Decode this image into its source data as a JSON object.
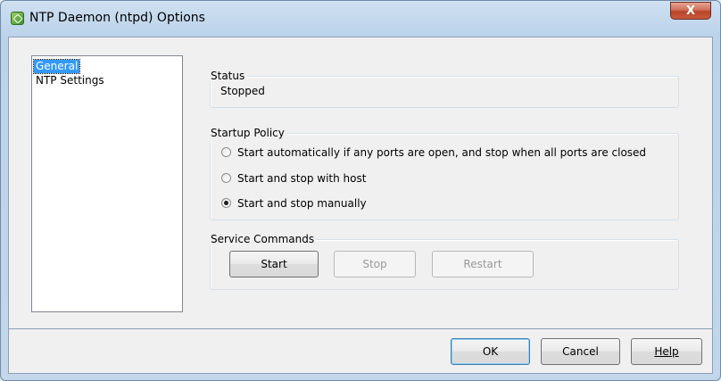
{
  "window": {
    "title": "NTP Daemon (ntpd) Options",
    "close_glyph": "X"
  },
  "nav": {
    "items": [
      {
        "label": "General",
        "selected": true
      },
      {
        "label": "NTP Settings",
        "selected": false
      }
    ]
  },
  "status": {
    "group_label": "Status",
    "value": "Stopped"
  },
  "startup_policy": {
    "group_label": "Startup Policy",
    "options": [
      {
        "label": "Start automatically if any ports are open, and stop when all ports are closed",
        "checked": false
      },
      {
        "label": "Start and stop with host",
        "checked": false
      },
      {
        "label": "Start and stop manually",
        "checked": true
      }
    ]
  },
  "service_commands": {
    "group_label": "Service Commands",
    "start_label": "Start",
    "stop_label": "Stop",
    "restart_label": "Restart"
  },
  "footer": {
    "ok_label": "OK",
    "cancel_label": "Cancel",
    "help_label": "Help"
  },
  "colors": {
    "selection": "#3399ff",
    "title_bar": "#bcd3ea",
    "close_button": "#c95b3e"
  },
  "icons": {
    "app": "ntp-service-icon",
    "close": "close-icon"
  }
}
